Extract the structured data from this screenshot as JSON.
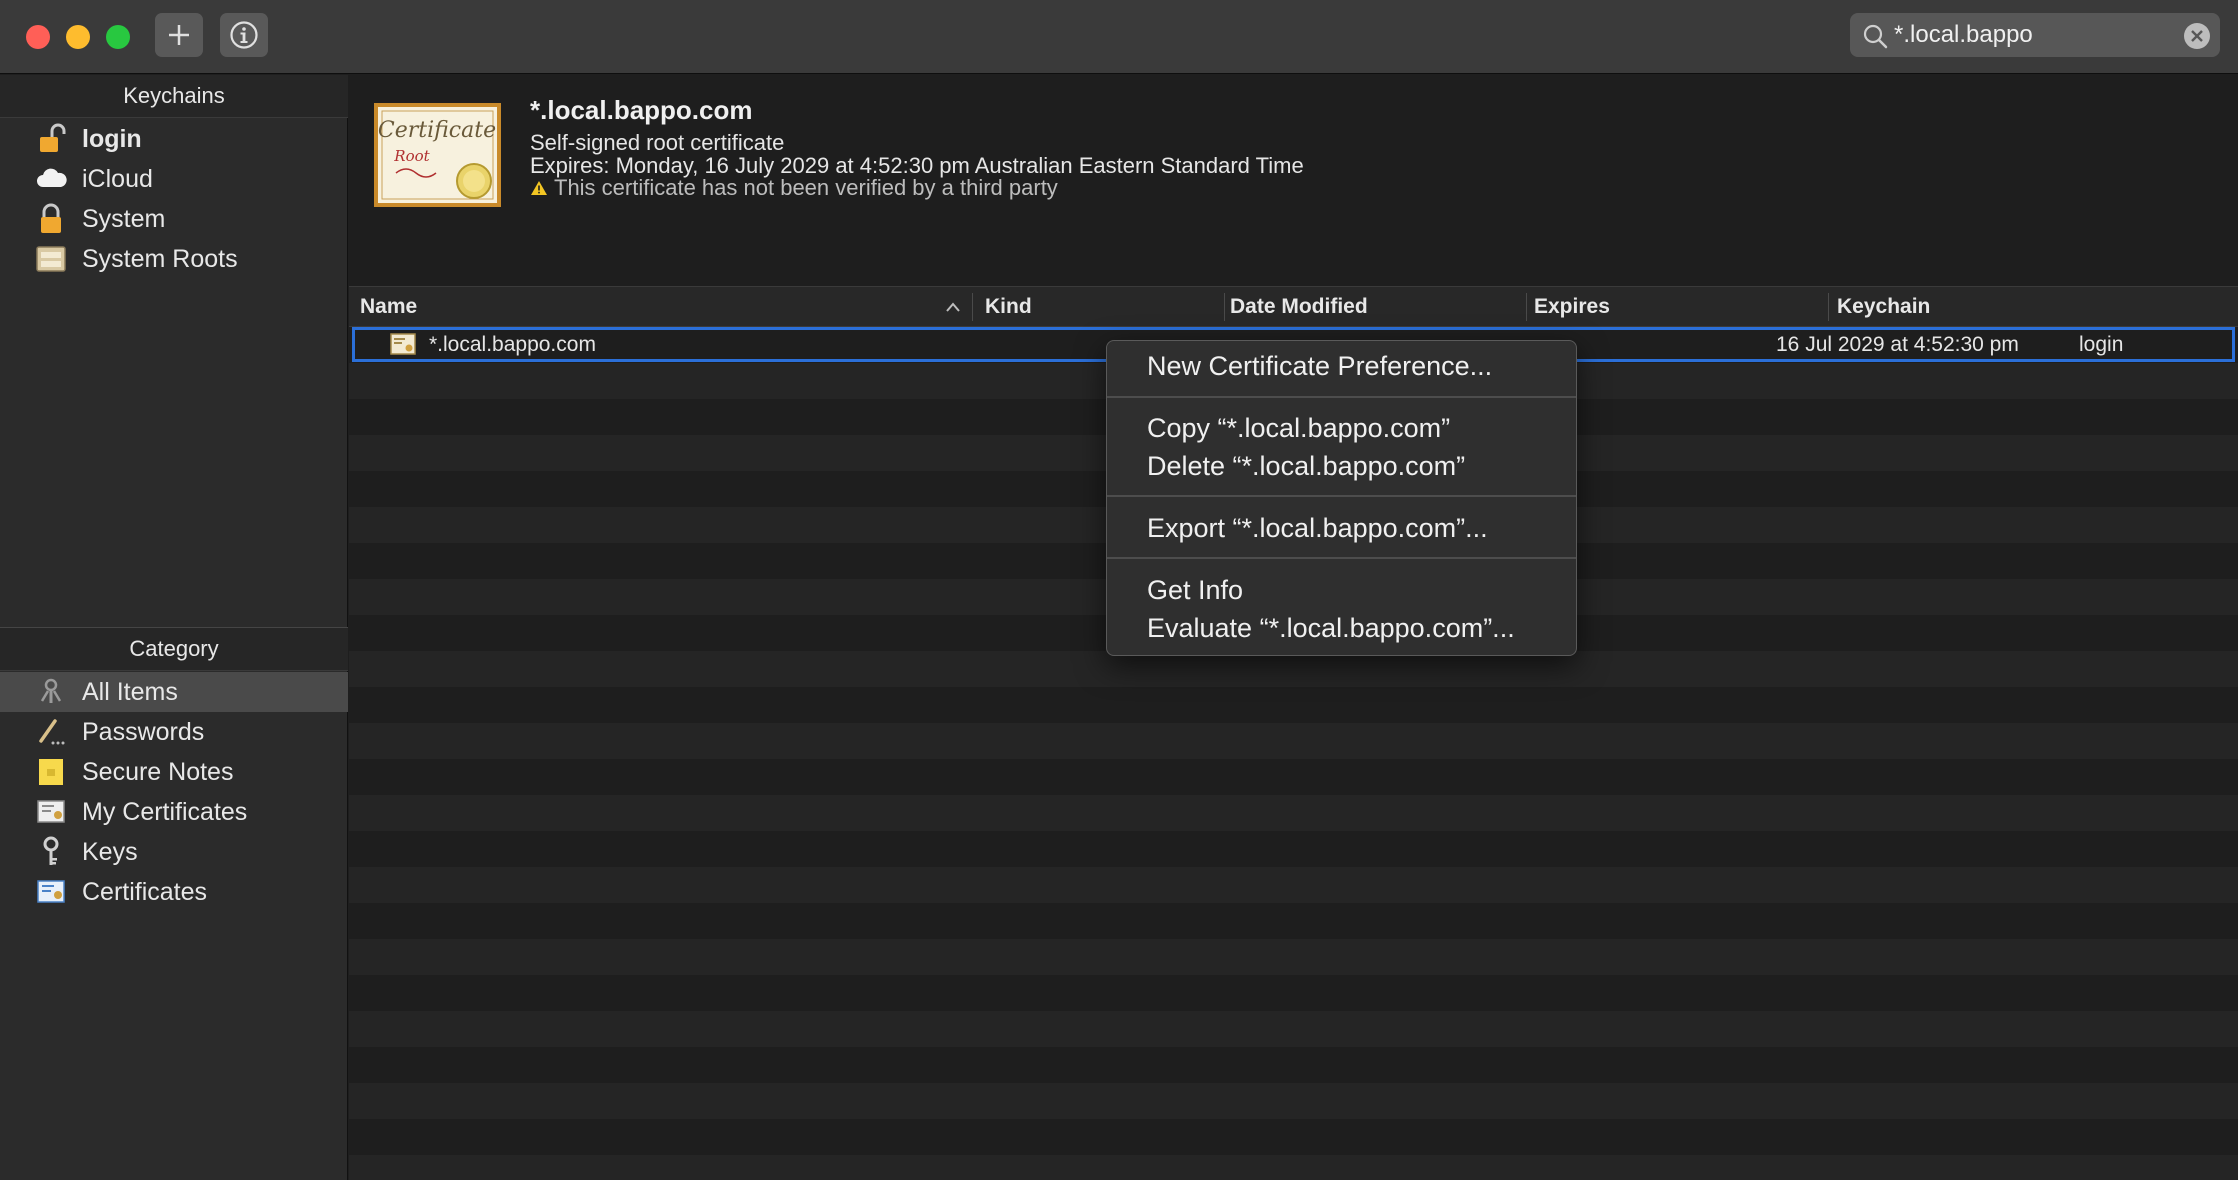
{
  "toolbar": {
    "colors": {
      "close": "#ff5f57",
      "minimize": "#febc2e",
      "zoom": "#28c840"
    },
    "add_icon": "plus-icon",
    "info_icon": "info-icon",
    "search": {
      "value": "*.local.bappo",
      "icon": "search-icon",
      "clear_icon": "clear-icon"
    }
  },
  "sidebar": {
    "keychains_header": "Keychains",
    "keychains": [
      {
        "label": "login",
        "icon": "unlocked-padlock-icon"
      },
      {
        "label": "iCloud",
        "icon": "cloud-icon"
      },
      {
        "label": "System",
        "icon": "padlock-icon"
      },
      {
        "label": "System Roots",
        "icon": "cabinet-icon"
      }
    ],
    "category_header": "Category",
    "categories": [
      {
        "label": "All Items",
        "icon": "all-items-icon",
        "selected": true
      },
      {
        "label": "Passwords",
        "icon": "pen-icon"
      },
      {
        "label": "Secure Notes",
        "icon": "note-icon"
      },
      {
        "label": "My Certificates",
        "icon": "my-certificate-icon"
      },
      {
        "label": "Keys",
        "icon": "key-icon"
      },
      {
        "label": "Certificates",
        "icon": "certificate-icon"
      }
    ]
  },
  "detail": {
    "title": "*.local.bappo.com",
    "subtitle": "Self-signed root certificate",
    "expires": "Expires: Monday, 16 July 2029 at 4:52:30 pm Australian Eastern Standard Time",
    "warning": "This certificate has not been verified by a third party",
    "cert_image_text": [
      "Certificate",
      "Root"
    ]
  },
  "table": {
    "columns": [
      "Name",
      "Kind",
      "Date Modified",
      "Expires",
      "Keychain"
    ],
    "sort_icon": "chevron-up-icon",
    "rows": [
      {
        "name": "*.local.bappo.com",
        "kind": "",
        "date_modified": "",
        "expires": "16 Jul 2029 at 4:52:30 pm",
        "keychain": "login"
      }
    ]
  },
  "context_menu": {
    "items": [
      "New Certificate Preference...",
      "Copy “*.local.bappo.com”",
      "Delete “*.local.bappo.com”",
      "Export “*.local.bappo.com”...",
      "Get Info",
      "Evaluate “*.local.bappo.com”..."
    ]
  }
}
